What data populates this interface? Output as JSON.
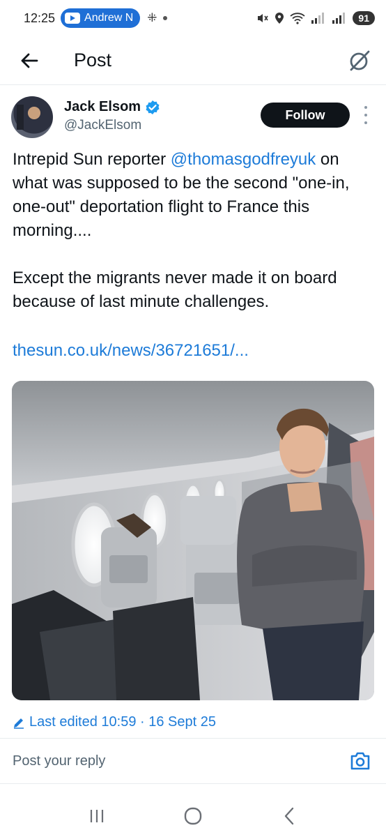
{
  "status_bar": {
    "time": "12:25",
    "chip_label": "Andrew N",
    "battery": "91"
  },
  "header": {
    "title": "Post"
  },
  "post": {
    "author_name": "Jack Elsom",
    "author_handle": "@JackElsom",
    "follow_label": "Follow",
    "text_before_mention": "Intrepid Sun reporter ",
    "mention": "@thomasgodfreyuk",
    "text_after_mention": " on what was supposed to be the second \"one-in, one-out\" deportation flight to France this morning....",
    "paragraph2": "Except the migrants never made it on board because of last minute challenges.",
    "link": "thesun.co.uk/news/36721651/...",
    "edited": "Last edited 10:59 · 16 Sept 25"
  },
  "reply": {
    "placeholder": "Post your reply"
  },
  "colors": {
    "accent": "#1d7bd8",
    "text": "#0f1419",
    "secondary": "#536471",
    "verified": "#1d9bf0"
  }
}
